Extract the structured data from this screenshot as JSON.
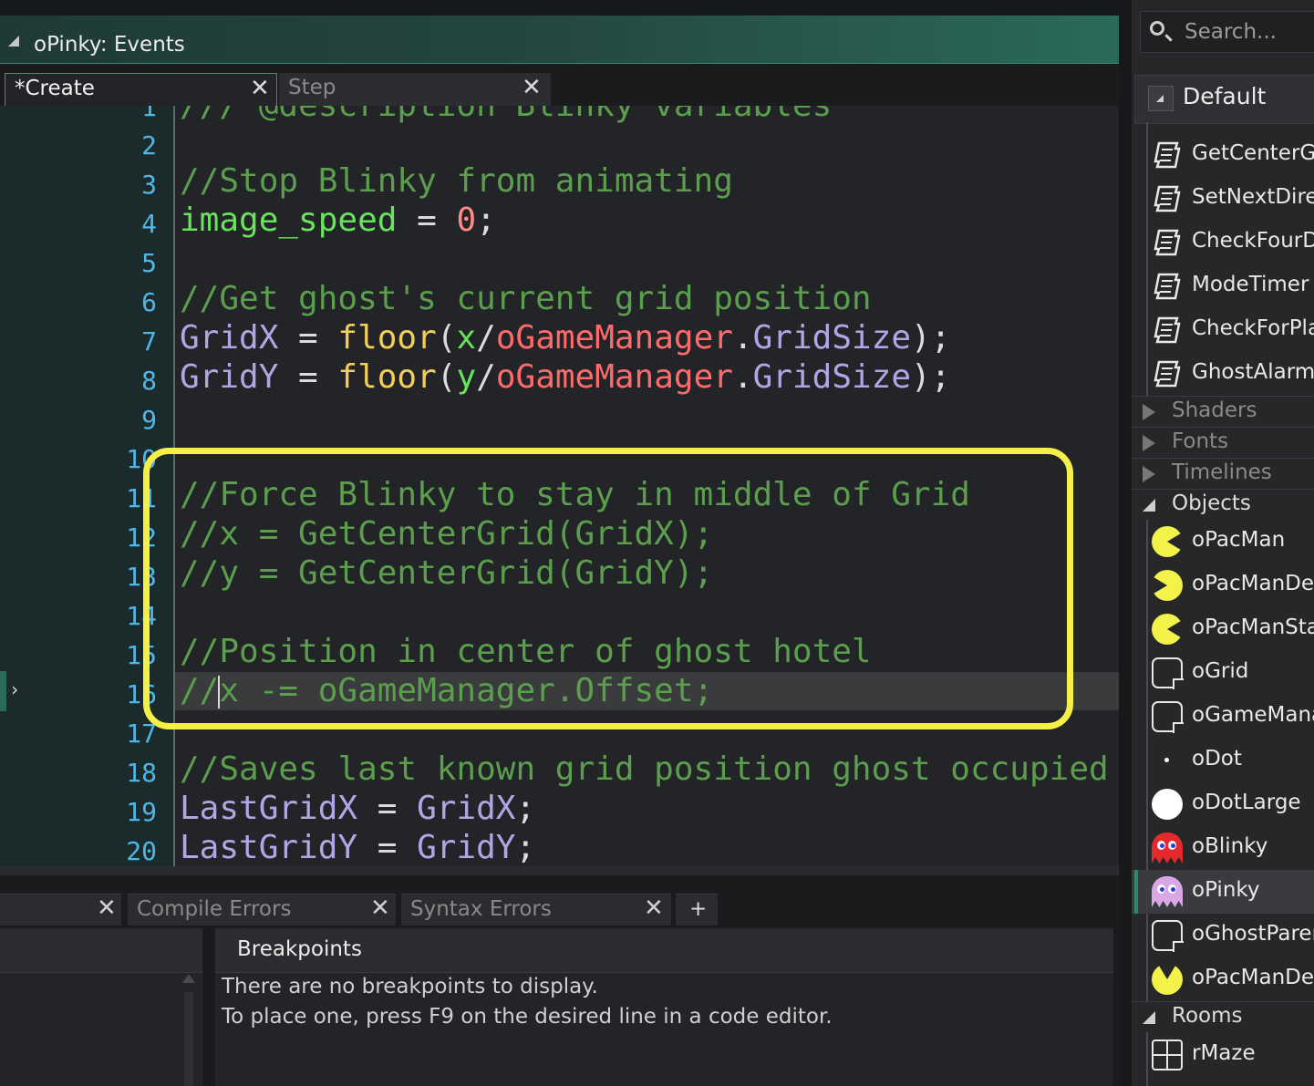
{
  "window": {
    "title": "oPinky: Events"
  },
  "event_tabs": [
    {
      "label": "*Create",
      "active": true
    },
    {
      "label": "Step",
      "active": false
    }
  ],
  "editor": {
    "first_line_partial": "/// @description Blinky variables",
    "line_numbers": [
      "1",
      "2",
      "3",
      "4",
      "5",
      "6",
      "7",
      "8",
      "9",
      "10",
      "11",
      "12",
      "13",
      "14",
      "15",
      "16",
      "17",
      "18",
      "19",
      "20"
    ],
    "lines": {
      "l3": "//Stop Blinky from animating",
      "l4": {
        "var": "image_speed",
        "eq": " = ",
        "num": "0",
        "end": ";"
      },
      "l6": "//Get ghost's current grid position",
      "l7": {
        "var": "GridX",
        "eq": " = ",
        "fn": "floor",
        "open": "(",
        "arg": "x",
        "slash": "/",
        "obj": "oGameManager",
        "dot": ".",
        "prop": "GridSize",
        "end": ");"
      },
      "l8": {
        "var": "GridY",
        "eq": " = ",
        "fn": "floor",
        "open": "(",
        "arg": "y",
        "slash": "/",
        "obj": "oGameManager",
        "dot": ".",
        "prop": "GridSize",
        "end": ");"
      },
      "l11": "//Force Blinky to stay in middle of Grid",
      "l12": "//x = GetCenterGrid(GridX);",
      "l13": "//y = GetCenterGrid(GridY);",
      "l15": "//Position in center of ghost hotel",
      "l16": "//x -= oGameManager.Offset;",
      "l18": "//Saves last known grid position ghost occupied",
      "l19": {
        "var": "LastGridX",
        "eq": " = ",
        "rhs": "GridX",
        "end": ";"
      },
      "l20": {
        "var": "LastGridY",
        "eq": " = ",
        "rhs": "GridY",
        "end": ";"
      }
    },
    "current_line": 16,
    "highlight_color": "#f4f049"
  },
  "output": {
    "tabs": [
      "Compile Errors",
      "Syntax Errors"
    ],
    "add_tab": "+",
    "breakpoints_title": "Breakpoints",
    "message_1": "There are no breakpoints to display.",
    "message_2": "To place one, press F9 on the desired line in a code editor."
  },
  "browser": {
    "search_placeholder": "Search...",
    "group": "Default",
    "scripts": [
      "GetCenterGr",
      "SetNextDire",
      "CheckFourD",
      "ModeTimer",
      "CheckForPla",
      "GhostAlarm"
    ],
    "categories": {
      "shaders": "Shaders",
      "fonts": "Fonts",
      "timelines": "Timelines",
      "objects": "Objects",
      "rooms": "Rooms"
    },
    "objects": [
      {
        "name": "oPacMan",
        "icon": "pacman-icon"
      },
      {
        "name": "oPacManDe",
        "icon": "pacman-icon"
      },
      {
        "name": "oPacManSta",
        "icon": "pacman-icon"
      },
      {
        "name": "oGrid",
        "icon": "no-sprite-icon"
      },
      {
        "name": "oGameMana",
        "icon": "no-sprite-icon"
      },
      {
        "name": "oDot",
        "icon": "dot-icon"
      },
      {
        "name": "oDotLarge",
        "icon": "large-dot-icon"
      },
      {
        "name": "oBlinky",
        "icon": "red-ghost-icon"
      },
      {
        "name": "oPinky",
        "icon": "pink-ghost-icon",
        "selected": true
      },
      {
        "name": "oGhostParen",
        "icon": "no-sprite-icon"
      },
      {
        "name": "oPacManDe",
        "icon": "pacman-icon"
      }
    ],
    "rooms": [
      "rMaze"
    ]
  }
}
